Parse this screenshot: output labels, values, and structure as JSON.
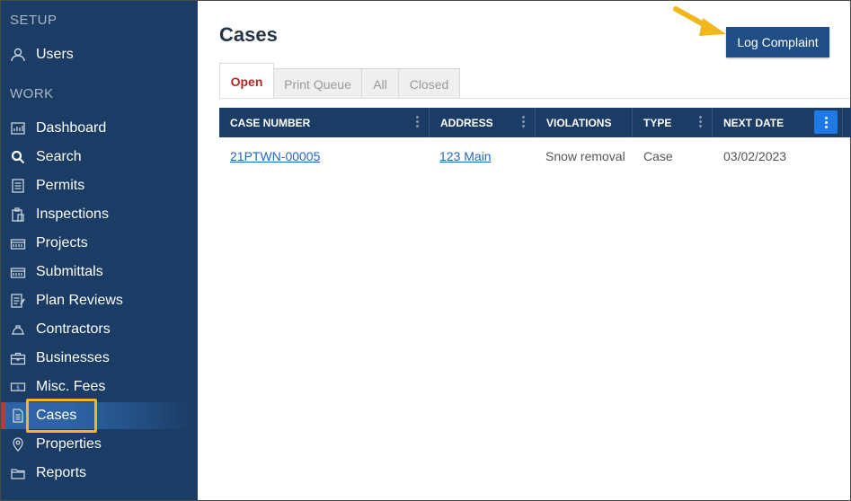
{
  "sidebar": {
    "setup_label": "SETUP",
    "work_label": "WORK",
    "setup_items": [
      {
        "label": "Users",
        "icon": "user-icon"
      }
    ],
    "work_items": [
      {
        "label": "Dashboard",
        "icon": "dashboard-icon"
      },
      {
        "label": "Search",
        "icon": "search-icon"
      },
      {
        "label": "Permits",
        "icon": "permits-icon"
      },
      {
        "label": "Inspections",
        "icon": "inspections-icon"
      },
      {
        "label": "Projects",
        "icon": "projects-icon"
      },
      {
        "label": "Submittals",
        "icon": "submittals-icon"
      },
      {
        "label": "Plan Reviews",
        "icon": "plan-reviews-icon"
      },
      {
        "label": "Contractors",
        "icon": "contractors-icon"
      },
      {
        "label": "Businesses",
        "icon": "businesses-icon"
      },
      {
        "label": "Misc. Fees",
        "icon": "misc-fees-icon"
      },
      {
        "label": "Cases",
        "icon": "cases-icon",
        "active": true
      },
      {
        "label": "Properties",
        "icon": "properties-icon"
      },
      {
        "label": "Reports",
        "icon": "reports-icon"
      }
    ]
  },
  "main": {
    "title": "Cases",
    "log_complaint_label": "Log Complaint",
    "tabs": [
      {
        "label": "Open",
        "active": true
      },
      {
        "label": "Print Queue"
      },
      {
        "label": "All"
      },
      {
        "label": "Closed"
      }
    ],
    "columns": [
      "CASE NUMBER",
      "ADDRESS",
      "VIOLATIONS",
      "TYPE",
      "NEXT DATE"
    ],
    "rows": [
      {
        "case_number": "21PTWN-00005",
        "address": "123 Main",
        "violations": "Snow removal",
        "type": "Case",
        "next_date": "03/02/2023"
      }
    ]
  },
  "colors": {
    "sidebar_bg": "#1b3c64",
    "active_accent": "#c8323c",
    "highlight": "#f0b81c",
    "button_bg": "#1f4e85",
    "link": "#1f67c2",
    "active_tab_text": "#b02a2a"
  }
}
